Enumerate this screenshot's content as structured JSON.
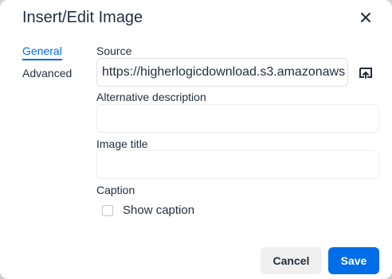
{
  "dialog": {
    "title": "Insert/Edit Image",
    "close_icon": "close-icon"
  },
  "tabs": [
    {
      "label": "General",
      "active": true
    },
    {
      "label": "Advanced",
      "active": false
    }
  ],
  "fields": {
    "source": {
      "label": "Source",
      "value": "https://higherlogicdownload.s3.amazonaws",
      "browse_icon": "browse-upload-icon"
    },
    "alt": {
      "label": "Alternative description",
      "value": ""
    },
    "image_title": {
      "label": "Image title",
      "value": ""
    },
    "caption": {
      "label": "Caption",
      "checkbox_label": "Show caption",
      "checked": false
    }
  },
  "footer": {
    "cancel_label": "Cancel",
    "save_label": "Save"
  },
  "colors": {
    "accent": "#006ce7",
    "text": "#222f3e",
    "secondary_button": "#f0f0f0"
  }
}
